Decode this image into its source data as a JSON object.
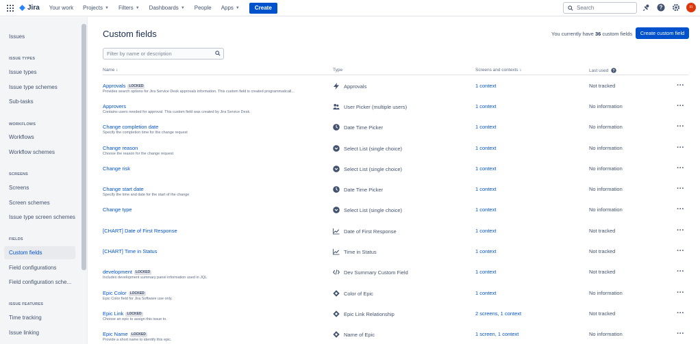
{
  "topnav": {
    "logo": "Jira",
    "items": [
      {
        "label": "Your work",
        "chevron": false
      },
      {
        "label": "Projects",
        "chevron": true
      },
      {
        "label": "Filters",
        "chevron": true
      },
      {
        "label": "Dashboards",
        "chevron": true
      },
      {
        "label": "People",
        "chevron": false
      },
      {
        "label": "Apps",
        "chevron": true
      }
    ],
    "create_label": "Create",
    "search_placeholder": "Search",
    "avatar_initials": "FI"
  },
  "sidebar": {
    "title": "Issues",
    "sections": [
      {
        "label": "ISSUE TYPES",
        "items": [
          "Issue types",
          "Issue type schemes",
          "Sub-tasks"
        ]
      },
      {
        "label": "WORKFLOWS",
        "items": [
          "Workflows",
          "Workflow schemes"
        ]
      },
      {
        "label": "SCREENS",
        "items": [
          "Screens",
          "Screen schemes",
          "Issue type screen schemes"
        ]
      },
      {
        "label": "FIELDS",
        "items": [
          "Custom fields",
          "Field configurations",
          "Field configuration sche..."
        ]
      },
      {
        "label": "ISSUE FEATURES",
        "items": [
          "Time tracking",
          "Issue linking"
        ]
      }
    ],
    "active_item": "Custom fields"
  },
  "main": {
    "title": "Custom fields",
    "count_prefix": "You currently have ",
    "count_value": "36",
    "count_suffix": " custom fields",
    "create_button": "Create custom field",
    "filter_placeholder": "Filter by name or description",
    "columns": {
      "name": "Name",
      "type": "Type",
      "screens": "Screens and contexts",
      "last_used": "Last used"
    },
    "rows": [
      {
        "name": "Approvals",
        "locked": "LOCKED",
        "desc": "Provides search options for Jira Service Desk approvals information. This custom field is created programmaticall...",
        "type": "Approvals",
        "type_icon": "lightning-icon",
        "ctx": "1 context",
        "last": "Not tracked"
      },
      {
        "name": "Approvers",
        "locked": "",
        "desc": "Contains users needed for approval. This custom field was created by Jira Service Desk.",
        "type": "User Picker (multiple users)",
        "type_icon": "users-icon",
        "ctx": "1 context",
        "last": "No information"
      },
      {
        "name": "Change completion date",
        "locked": "",
        "desc": "Specify the completion time for the change request",
        "type": "Date Time Picker",
        "type_icon": "clock-icon",
        "ctx": "1 context",
        "last": "No information"
      },
      {
        "name": "Change reason",
        "locked": "",
        "desc": "Choose the reason for the change request",
        "type": "Select List (single choice)",
        "type_icon": "select-icon",
        "ctx": "1 context",
        "last": "No information"
      },
      {
        "name": "Change risk",
        "locked": "",
        "desc": "",
        "type": "Select List (single choice)",
        "type_icon": "select-icon",
        "ctx": "1 context",
        "last": "No information"
      },
      {
        "name": "Change start date",
        "locked": "",
        "desc": "Specify the time and date for the start of the change",
        "type": "Date Time Picker",
        "type_icon": "clock-icon",
        "ctx": "1 context",
        "last": "No information"
      },
      {
        "name": "Change type",
        "locked": "",
        "desc": "",
        "type": "Select List (single choice)",
        "type_icon": "select-icon",
        "ctx": "1 context",
        "last": "No information"
      },
      {
        "name": "[CHART] Date of First Response",
        "locked": "",
        "desc": "",
        "type": "Date of First Response",
        "type_icon": "chart-icon",
        "ctx": "1 context",
        "last": "Not tracked"
      },
      {
        "name": "[CHART] Time in Status",
        "locked": "",
        "desc": "",
        "type": "Time in Status",
        "type_icon": "chart-icon",
        "ctx": "1 context",
        "last": "Not tracked"
      },
      {
        "name": "development",
        "locked": "LOCKED",
        "desc": "Includes development summary panel information used in JQL",
        "type": "Dev Summary Custom Field",
        "type_icon": "code-icon",
        "ctx": "1 context",
        "last": "Not tracked"
      },
      {
        "name": "Epic Color",
        "locked": "LOCKED",
        "desc": "Epic Color field for Jira Software use only.",
        "type": "Color of Epic",
        "type_icon": "diamond-icon",
        "ctx": "1 context",
        "last": "No information"
      },
      {
        "name": "Epic Link",
        "locked": "LOCKED",
        "desc": "Choose an epic to assign this issue to.",
        "type": "Epic Link Relationship",
        "type_icon": "diamond-icon",
        "ctx": "2 screens, 1 context",
        "last": "Not tracked"
      },
      {
        "name": "Epic Name",
        "locked": "LOCKED",
        "desc": "Provide a short name to identify this epic.",
        "type": "Name of Epic",
        "type_icon": "diamond-icon",
        "ctx": "1 screen, 1 context",
        "last": "No information"
      }
    ]
  }
}
